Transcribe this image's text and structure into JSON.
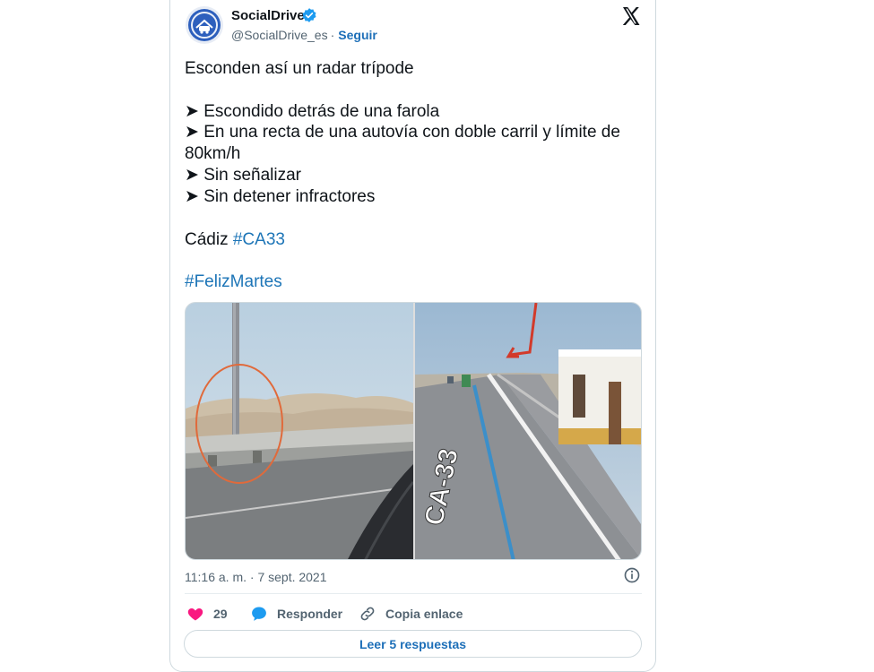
{
  "account": {
    "name": "SocialDrive",
    "handle": "@SocialDrive_es",
    "separator": "·",
    "follow_label": "Seguir"
  },
  "tweet": {
    "line1": "Esconden así un radar trípode",
    "bullet": "➤",
    "item1": "Escondido detrás de una farola",
    "item2": "En una recta de una autovía con doble carril y límite de",
    "item2_cont": "80km/h",
    "item3": "Sin señalizar",
    "item4": "Sin detener infractores",
    "location": "Cádiz",
    "hashtag1": "#CA33",
    "hashtag2": "#FelizMartes"
  },
  "media": {
    "road_label": "CA-33"
  },
  "meta": {
    "timestamp": "11:16 a. m. · 7 sept. 2021"
  },
  "actions": {
    "likes": "29",
    "reply_label": "Responder",
    "copy_label": "Copia enlace",
    "read_replies_label": "Leer 5 respuestas"
  },
  "colors": {
    "link": "#1d75b7",
    "like": "#f91880",
    "reply": "#1d9bf0",
    "verified": "#1d9bf0"
  }
}
